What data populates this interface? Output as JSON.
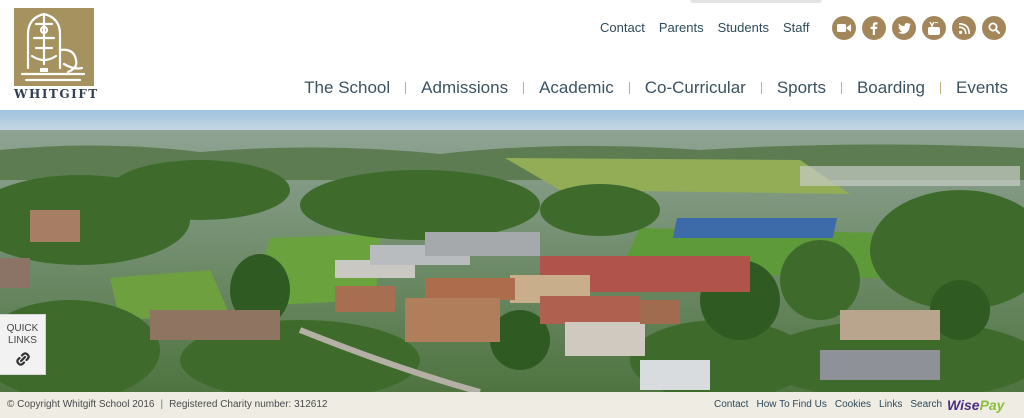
{
  "brand": {
    "logo_text": "WHITGIFT",
    "logo_color": "#a6925e"
  },
  "top_links": [
    {
      "label": "Contact"
    },
    {
      "label": "Parents"
    },
    {
      "label": "Students"
    },
    {
      "label": "Staff"
    }
  ],
  "social_icons": [
    {
      "name": "video-camera-icon"
    },
    {
      "name": "facebook-icon"
    },
    {
      "name": "twitter-icon"
    },
    {
      "name": "youtube-icon"
    },
    {
      "name": "rss-icon"
    },
    {
      "name": "search-icon"
    }
  ],
  "main_nav": [
    {
      "label": "The School"
    },
    {
      "label": "Admissions"
    },
    {
      "label": "Academic"
    },
    {
      "label": "Co-Curricular"
    },
    {
      "label": "Sports"
    },
    {
      "label": "Boarding"
    },
    {
      "label": "Events"
    }
  ],
  "quick_links": {
    "line1": "QUICK",
    "line2": "LINKS",
    "icon": "link-icon"
  },
  "footer": {
    "copyright": "© Copyright Whitgift School 2016",
    "charity": "Registered Charity number: 312612",
    "links": [
      {
        "label": "Contact"
      },
      {
        "label": "How To Find Us"
      },
      {
        "label": "Cookies"
      },
      {
        "label": "Links"
      },
      {
        "label": "Search"
      }
    ],
    "wisepay_part1": "Wise",
    "wisepay_part2": "Pay"
  },
  "colors": {
    "accent_gold": "#a3875a",
    "nav_text": "#3c5363",
    "footer_bg": "#eeece3"
  }
}
